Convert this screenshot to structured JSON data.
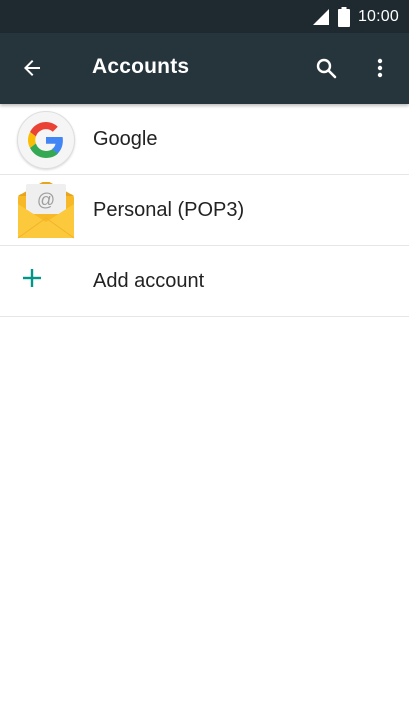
{
  "status_bar": {
    "time": "10:00"
  },
  "toolbar": {
    "title": "Accounts",
    "back_icon": "arrow-back-icon",
    "search_icon": "search-icon",
    "more_icon": "more-vert-icon"
  },
  "accounts": [
    {
      "label": "Google",
      "icon": "google-icon"
    },
    {
      "label": "Personal (POP3)",
      "icon": "email-envelope-icon"
    }
  ],
  "add_account": {
    "label": "Add account",
    "icon": "plus-icon",
    "color": "#009688"
  },
  "colors": {
    "status_bar": "#1f2a30",
    "toolbar": "#26343c"
  }
}
